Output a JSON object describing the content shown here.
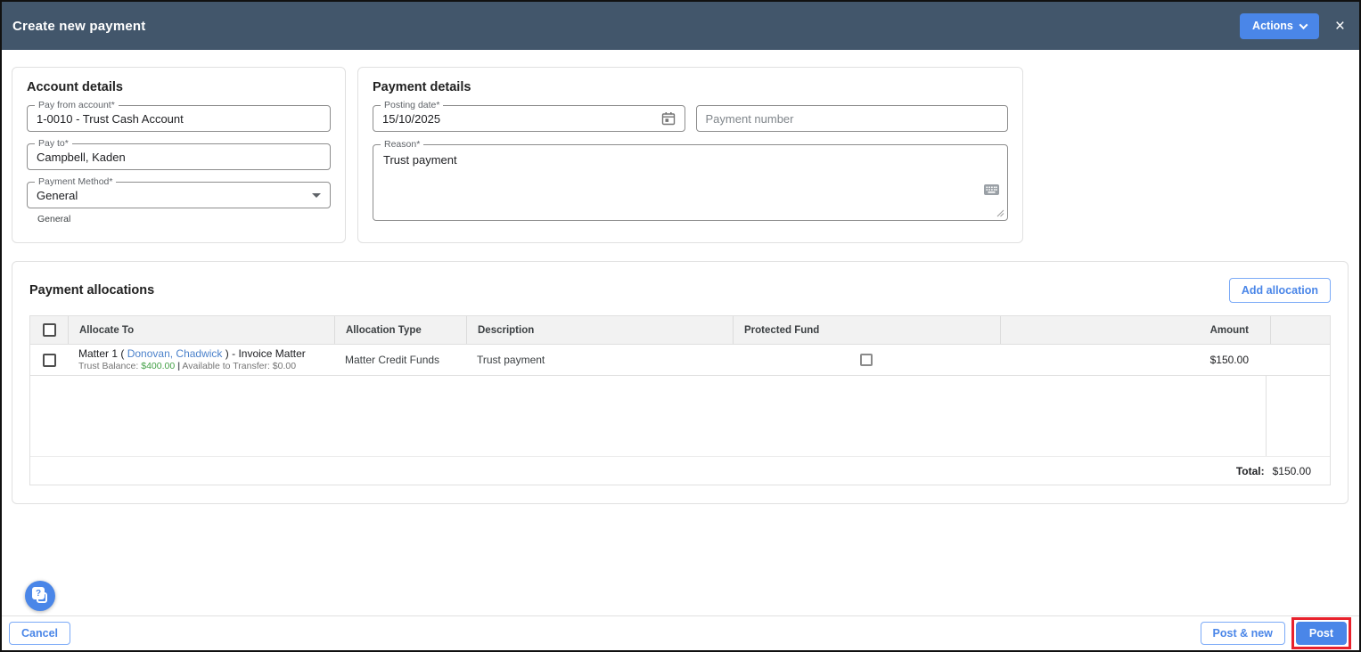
{
  "window": {
    "title": "Create new payment",
    "actions_button": "Actions",
    "close_icon": "×"
  },
  "account_details": {
    "title": "Account details",
    "pay_from_account": {
      "label": "Pay from account*",
      "value": "1-0010 - Trust Cash Account"
    },
    "pay_to": {
      "label": "Pay to*",
      "value": "Campbell, Kaden"
    },
    "payment_method": {
      "label": "Payment Method*",
      "value": "General",
      "helper_text": "General"
    }
  },
  "payment_details": {
    "title": "Payment details",
    "posting_date": {
      "label": "Posting date*",
      "value": "15/10/2025"
    },
    "payment_number": {
      "placeholder": "Payment number"
    },
    "reason": {
      "label": "Reason*",
      "value": "Trust payment"
    }
  },
  "payment_allocations": {
    "title": "Payment allocations",
    "add_allocation_button": "Add allocation",
    "table": {
      "columns": [
        "Allocate To",
        "Allocation Type",
        "Description",
        "Protected Fund",
        "Amount"
      ],
      "rows": [
        {
          "allocate_to_prefix": "Matter 1 (",
          "allocate_to_link": "Donovan, Chadwick",
          "allocate_to_suffix": ") - Invoice Matter",
          "trust_balance_label": "Trust Balance:",
          "trust_balance_value": "$400.00",
          "detail_separator": "|",
          "available_to_transfer": "Available to Transfer: $0.00",
          "allocation_type": "Matter Credit Funds",
          "description": "Trust payment",
          "protected_fund_checked": false,
          "amount": "$150.00"
        }
      ],
      "total_label": "Total:",
      "total_amount": "$150.00"
    }
  },
  "footer": {
    "cancel_button": "Cancel",
    "post_and_new_button": "Post & new",
    "post_button": "Post"
  },
  "help": {
    "icon_glyph": "?"
  },
  "colors": {
    "titlebar_bg": "#42566b",
    "primary_blue": "#4a86e8",
    "link_blue": "#4c82cb",
    "positive_green": "#43a047",
    "annotation_red": "#e8212c"
  }
}
